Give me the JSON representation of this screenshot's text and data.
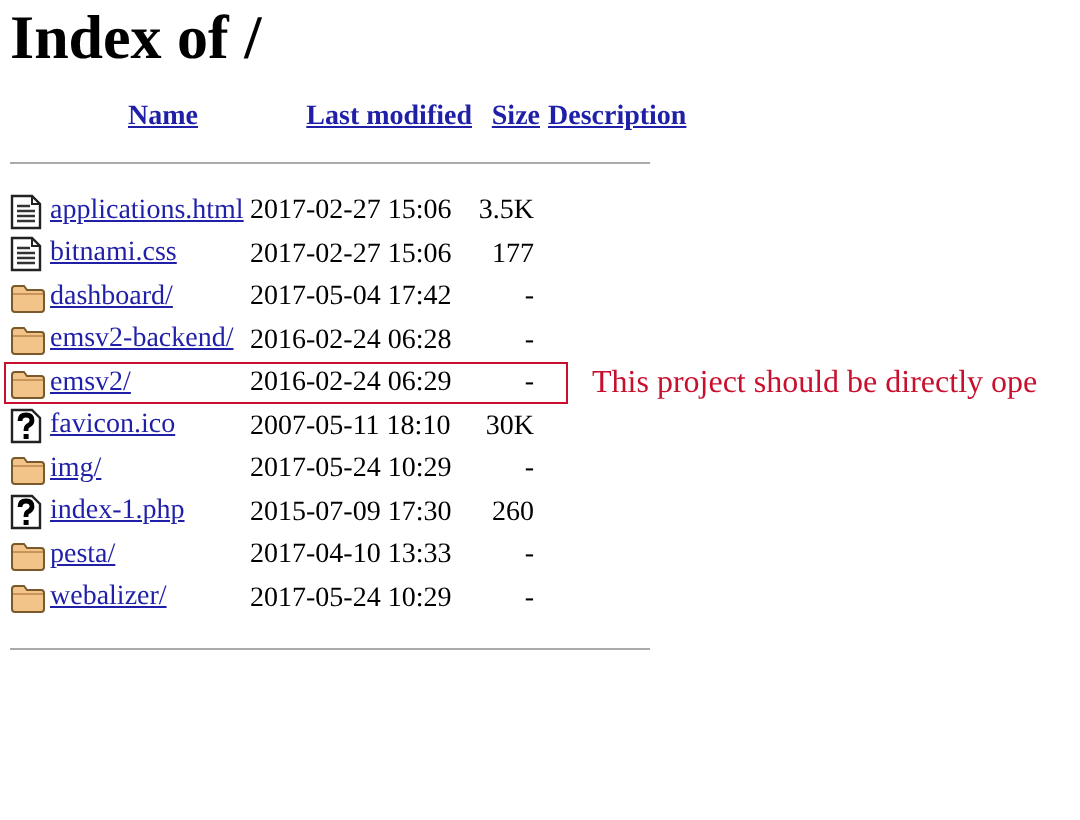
{
  "title": "Index of /",
  "columns": [
    {
      "label": "Name"
    },
    {
      "label": "Last modified"
    },
    {
      "label": "Size"
    },
    {
      "label": "Description"
    }
  ],
  "rows": [
    {
      "kind": "text",
      "name": "applications.html",
      "modified": "2017-02-27 15:06",
      "size": "3.5K",
      "highlighted": false
    },
    {
      "kind": "text",
      "name": "bitnami.css",
      "modified": "2017-02-27 15:06",
      "size": "177",
      "highlighted": false
    },
    {
      "kind": "folder",
      "name": "dashboard/",
      "modified": "2017-05-04 17:42",
      "size": "-",
      "highlighted": false
    },
    {
      "kind": "folder",
      "name": "emsv2-backend/",
      "modified": "2016-02-24 06:28",
      "size": "-",
      "highlighted": false
    },
    {
      "kind": "folder",
      "name": "emsv2/",
      "modified": "2016-02-24 06:29",
      "size": "-",
      "highlighted": true,
      "note": "This project should be directly ope"
    },
    {
      "kind": "unknown",
      "name": "favicon.ico",
      "modified": "2007-05-11 18:10",
      "size": "30K",
      "highlighted": false
    },
    {
      "kind": "folder",
      "name": "img/",
      "modified": "2017-05-24 10:29",
      "size": "-",
      "highlighted": false
    },
    {
      "kind": "unknown",
      "name": "index-1.php",
      "modified": "2015-07-09 17:30",
      "size": "260",
      "highlighted": false
    },
    {
      "kind": "folder",
      "name": "pesta/",
      "modified": "2017-04-10 13:33",
      "size": "-",
      "highlighted": false
    },
    {
      "kind": "folder",
      "name": "webalizer/",
      "modified": "2017-05-24 10:29",
      "size": "-",
      "highlighted": false
    }
  ]
}
